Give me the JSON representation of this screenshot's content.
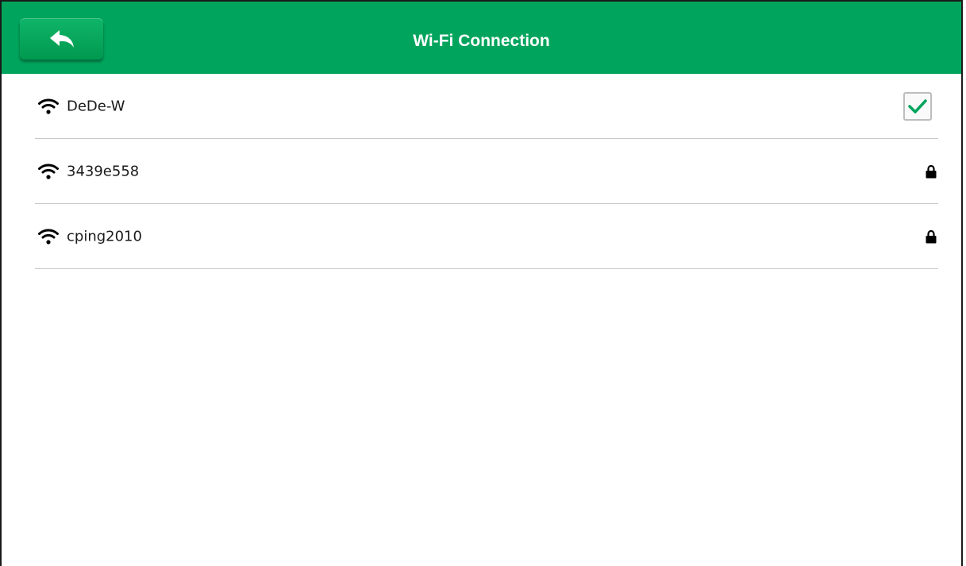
{
  "header": {
    "title": "Wi-Fi Connection",
    "back_icon": "back-arrow-icon",
    "background_color": "#00a45c"
  },
  "networks": [
    {
      "ssid": "DeDe-W",
      "connected": true,
      "secured": false,
      "signal_icon": "wifi-icon",
      "status_icon": "checkbox-checked-icon"
    },
    {
      "ssid": "3439e558",
      "connected": false,
      "secured": true,
      "signal_icon": "wifi-icon",
      "status_icon": "lock-icon"
    },
    {
      "ssid": "cping2010",
      "connected": false,
      "secured": true,
      "signal_icon": "wifi-icon",
      "status_icon": "lock-icon"
    }
  ],
  "colors": {
    "accent": "#00a45c",
    "check": "#00a45c",
    "divider": "#c8c8c8"
  }
}
